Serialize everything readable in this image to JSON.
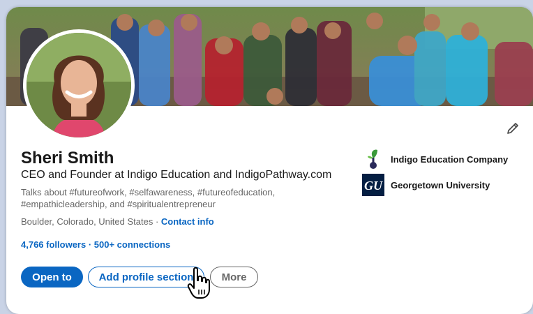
{
  "profile": {
    "name": "Sheri Smith",
    "headline": "CEO and Founder at Indigo Education and IndigoPathway.com",
    "talks_about": "Talks about #futureofwork, #selfawareness, #futureofeducation, #empathicleadership, and #spiritualentrepreneur",
    "location": "Boulder, Colorado, United States",
    "location_separator": " · ",
    "contact_info_label": "Contact info",
    "followers": "4,766 followers",
    "network_separator": " · ",
    "connections": "500+ connections"
  },
  "actions": {
    "open_to_label": "Open to",
    "add_section_label": "Add profile section",
    "more_label": "More"
  },
  "organizations": [
    {
      "name": "Indigo Education Company",
      "icon": "indigo-sprout-logo"
    },
    {
      "name": "Georgetown University",
      "icon": "georgetown-gu-logo",
      "logo_text": "GU"
    }
  ],
  "colors": {
    "accent": "#0a66c2",
    "text_primary": "#191919",
    "text_secondary": "#666666",
    "georgetown_navy": "#041e42"
  },
  "icons": {
    "edit": "pencil-icon",
    "cursor": "hand-pointer-icon"
  }
}
